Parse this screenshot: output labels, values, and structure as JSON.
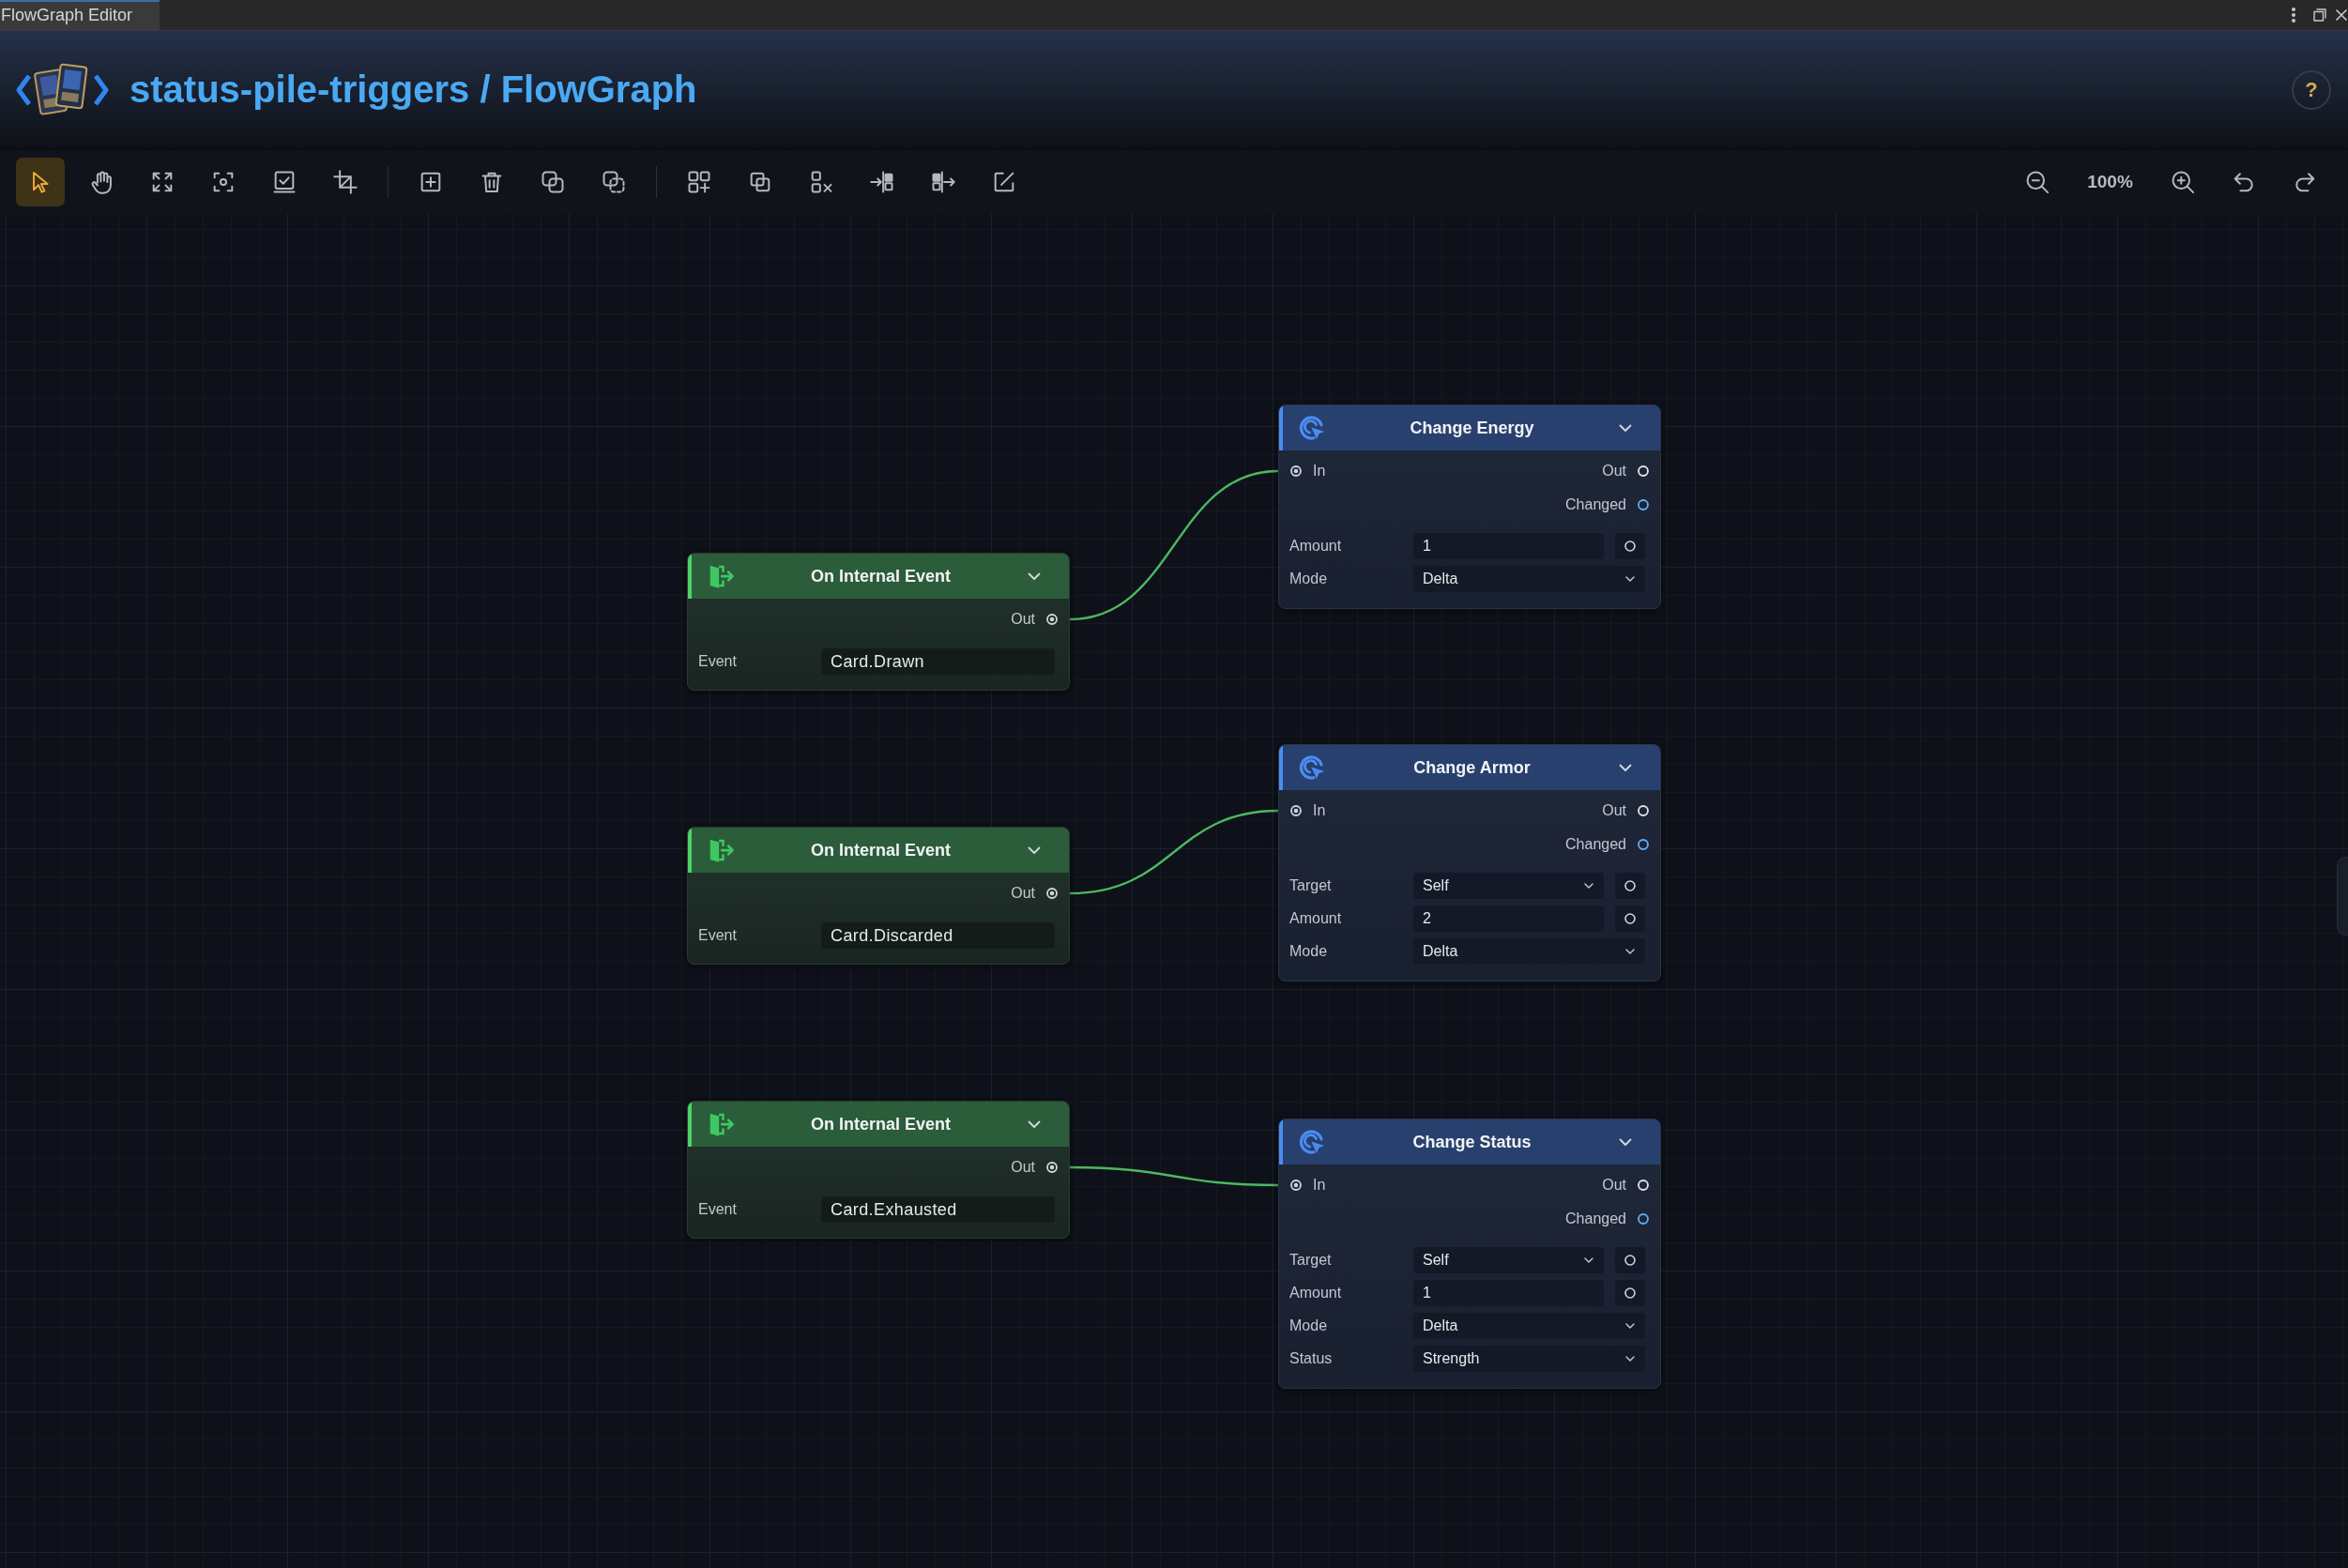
{
  "window": {
    "tab": "FlowGraph Editor"
  },
  "header": {
    "title": "status-pile-triggers / FlowGraph",
    "help": "?"
  },
  "toolbar": {
    "groups": [
      [
        {
          "selected": true
        },
        {
          "selected": false
        },
        {
          "selected": false
        },
        {
          "selected": false
        },
        {
          "selected": false
        },
        {
          "selected": false
        }
      ],
      [
        {
          "selected": false
        },
        {
          "selected": false
        },
        {
          "selected": false
        },
        {
          "selected": false
        }
      ],
      [
        {
          "selected": false
        },
        {
          "selected": false
        },
        {
          "selected": false
        },
        {
          "selected": false
        },
        {
          "selected": false
        },
        {
          "selected": false
        }
      ]
    ],
    "zoom": "100%"
  },
  "graph": {
    "nodes": [
      {
        "kind": "event",
        "title": "On Internal Event",
        "outputs": [
          {
            "label": "Out",
            "connected": true,
            "color": "#d2d4d8"
          }
        ],
        "fields": [
          {
            "kind": "input",
            "label": "Event",
            "value": "Card.Drawn",
            "port": false
          }
        ]
      },
      {
        "kind": "action",
        "title": "Change Energy",
        "inputs": [
          {
            "label": "In",
            "connected": true
          }
        ],
        "outputs": [
          {
            "label": "Out",
            "connected": false,
            "color": "#e2e4e8"
          },
          {
            "label": "Changed",
            "connected": false,
            "color": "#62aef6"
          }
        ],
        "fields": [
          {
            "kind": "input",
            "label": "Amount",
            "value": "1",
            "port": true
          },
          {
            "kind": "dropdown",
            "label": "Mode",
            "value": "Delta",
            "port": false
          }
        ]
      },
      {
        "kind": "event",
        "title": "On Internal Event",
        "outputs": [
          {
            "label": "Out",
            "connected": true,
            "color": "#d2d4d8"
          }
        ],
        "fields": [
          {
            "kind": "input",
            "label": "Event",
            "value": "Card.Discarded",
            "port": false
          }
        ]
      },
      {
        "kind": "action",
        "title": "Change Armor",
        "inputs": [
          {
            "label": "In",
            "connected": true
          }
        ],
        "outputs": [
          {
            "label": "Out",
            "connected": false,
            "color": "#e2e4e8"
          },
          {
            "label": "Changed",
            "connected": false,
            "color": "#62aef6"
          }
        ],
        "fields": [
          {
            "kind": "dropdown",
            "label": "Target",
            "value": "Self",
            "port": true
          },
          {
            "kind": "input",
            "label": "Amount",
            "value": "2",
            "port": true
          },
          {
            "kind": "dropdown",
            "label": "Mode",
            "value": "Delta",
            "port": false
          }
        ]
      },
      {
        "kind": "event",
        "title": "On Internal Event",
        "outputs": [
          {
            "label": "Out",
            "connected": true,
            "color": "#d2d4d8"
          }
        ],
        "fields": [
          {
            "kind": "input",
            "label": "Event",
            "value": "Card.Exhausted",
            "port": false
          }
        ]
      },
      {
        "kind": "action",
        "title": "Change Status",
        "inputs": [
          {
            "label": "In",
            "connected": true
          }
        ],
        "outputs": [
          {
            "label": "Out",
            "connected": false,
            "color": "#e2e4e8"
          },
          {
            "label": "Changed",
            "connected": false,
            "color": "#62aef6"
          }
        ],
        "fields": [
          {
            "kind": "dropdown",
            "label": "Target",
            "value": "Self",
            "port": true
          },
          {
            "kind": "input",
            "label": "Amount",
            "value": "1",
            "port": true
          },
          {
            "kind": "dropdown",
            "label": "Mode",
            "value": "Delta",
            "port": false
          },
          {
            "kind": "dropdown",
            "label": "Status",
            "value": "Strength",
            "port": false
          }
        ]
      }
    ]
  }
}
